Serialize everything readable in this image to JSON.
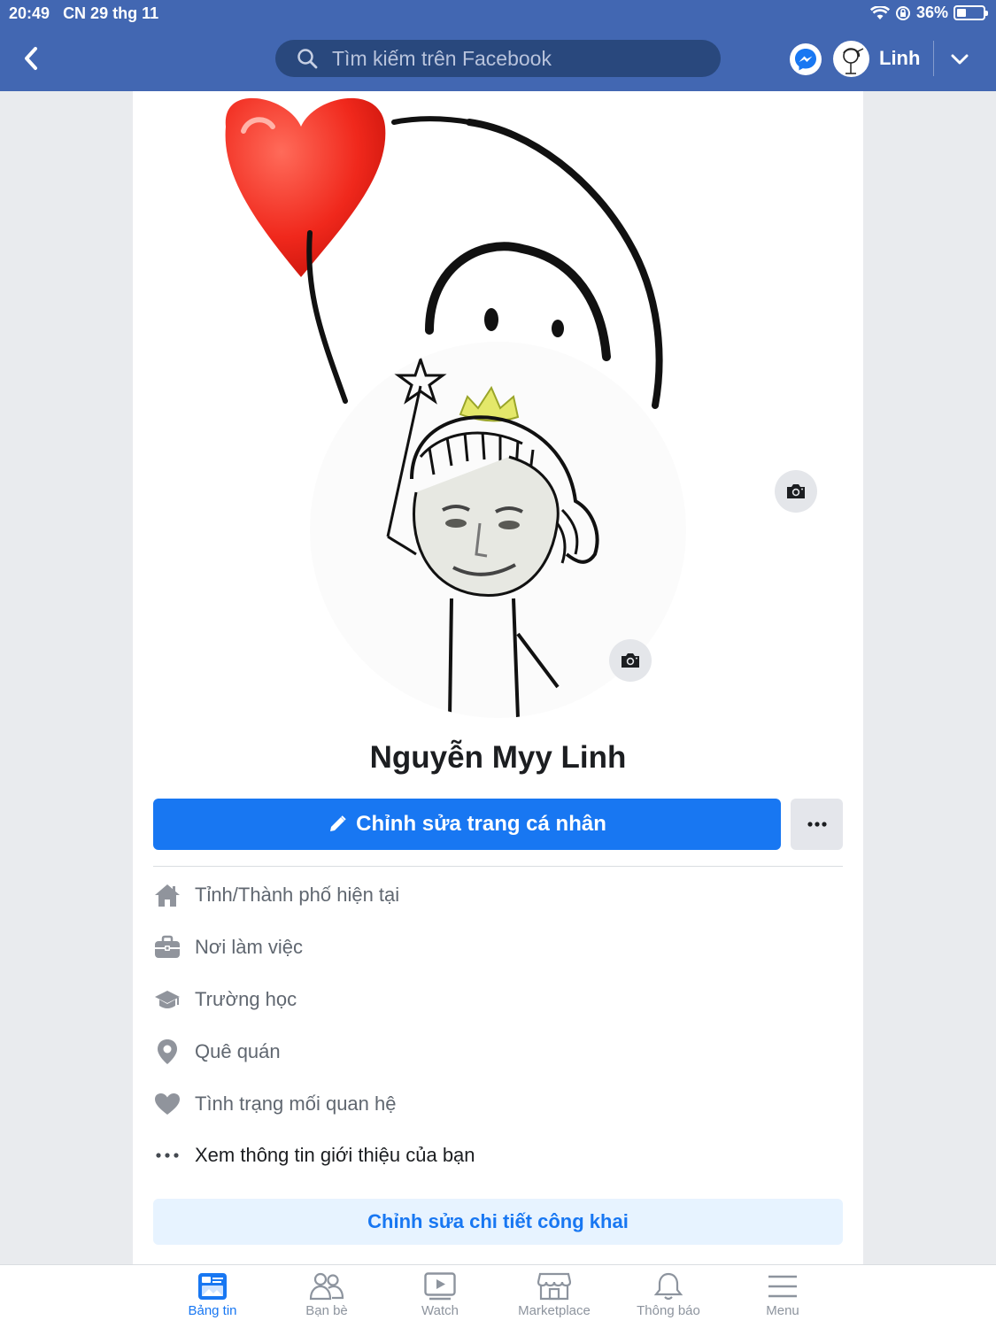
{
  "status_bar": {
    "time": "20:49",
    "date": "CN 29 thg 11",
    "battery": "36%"
  },
  "header": {
    "search_placeholder": "Tìm kiếm trên Facebook",
    "user_name": "Linh"
  },
  "profile": {
    "name": "Nguyễn Myy Linh",
    "edit_profile_label": "Chỉnh sửa trang cá nhân"
  },
  "about": {
    "items": [
      {
        "label": "Tỉnh/Thành phố hiện tại",
        "icon": "home-icon"
      },
      {
        "label": "Nơi làm việc",
        "icon": "briefcase-icon"
      },
      {
        "label": "Trường học",
        "icon": "graduation-cap-icon"
      },
      {
        "label": "Quê quán",
        "icon": "location-pin-icon"
      },
      {
        "label": "Tình trạng mối quan hệ",
        "icon": "heart-icon"
      },
      {
        "label": "Xem thông tin giới thiệu của bạn",
        "icon": "ellipsis-icon"
      }
    ],
    "edit_public_label": "Chỉnh sửa chi tiết công khai"
  },
  "tabbar": {
    "tabs": [
      {
        "label": "Bảng tin",
        "active": true
      },
      {
        "label": "Bạn bè"
      },
      {
        "label": "Watch"
      },
      {
        "label": "Marketplace"
      },
      {
        "label": "Thông báo"
      },
      {
        "label": "Menu"
      }
    ]
  },
  "colors": {
    "nav": "#4267b2",
    "primary": "#1877f2",
    "secondary_bg": "#e7f3ff"
  }
}
